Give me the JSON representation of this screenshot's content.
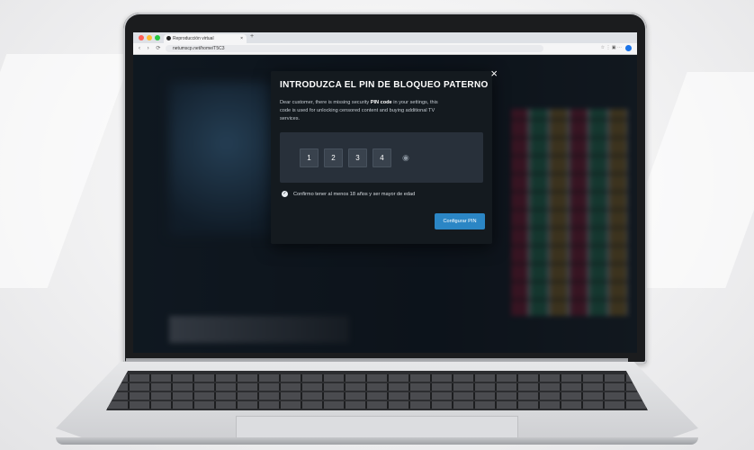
{
  "browser": {
    "tab_title": "Reproducción virtual",
    "tab_close": "×",
    "new_tab": "+",
    "nav_buttons": "‹ › ⟳",
    "url": "netumscp.net/home/T5C3",
    "tool_icons": "☆ ⋮ ▣ ⋯"
  },
  "modal": {
    "close_label": "×",
    "title": "INTRODUZCA EL PIN DE BLOQUEO PATERNO",
    "desc_prefix": "Dear customer, there is missing security ",
    "desc_bold": "PIN code",
    "desc_suffix": " in your settings, this code is used for unlocking censored content and buying additional TV services.",
    "pin_digits": [
      "1",
      "2",
      "3",
      "4"
    ],
    "eye_icon": "◉",
    "confirm_text": "Confirmo tener al menos 18 años y ser mayor de edad",
    "confirm_checked": true,
    "button_label": "Configurar PIN"
  },
  "colors": {
    "accent_button": "#2b86c5",
    "modal_bg": "#141a1f",
    "pin_box": "#28303a"
  }
}
